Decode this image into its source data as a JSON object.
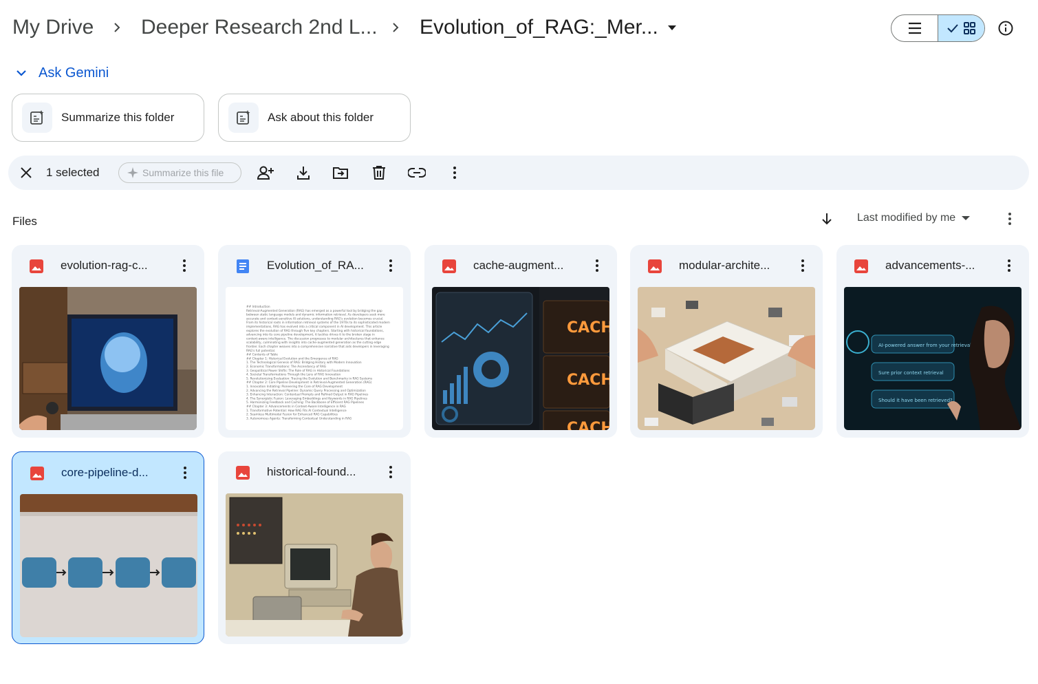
{
  "breadcrumb": {
    "root": "My Drive",
    "parent": "Deeper Research 2nd L...",
    "current": "Evolution_of_RAG:_Mer..."
  },
  "ask_gemini": {
    "label": "Ask Gemini",
    "actions": [
      {
        "label": "Summarize this folder",
        "icon": "gemini-doc-icon"
      },
      {
        "label": "Ask about this folder",
        "icon": "gemini-doc-icon"
      }
    ]
  },
  "selection_bar": {
    "count_label": "1 selected",
    "summarize_file": "Summarize this file",
    "actions": [
      "close-icon",
      "share-icon",
      "download-icon",
      "move-icon",
      "trash-icon",
      "link-icon",
      "more-vert-icon"
    ]
  },
  "files": {
    "section_label": "Files",
    "sort_label": "Last modified by me",
    "items": [
      {
        "name": "evolution-rag-c...",
        "type": "image",
        "icon": "image-file-icon",
        "selected": false
      },
      {
        "name": "Evolution_of_RA...",
        "type": "doc",
        "icon": "doc-file-icon",
        "selected": false
      },
      {
        "name": "cache-augment...",
        "type": "image",
        "icon": "image-file-icon",
        "selected": false
      },
      {
        "name": "modular-archite...",
        "type": "image",
        "icon": "image-file-icon",
        "selected": false
      },
      {
        "name": "advancements-...",
        "type": "image",
        "icon": "image-file-icon",
        "selected": false
      },
      {
        "name": "core-pipeline-d...",
        "type": "image",
        "icon": "image-file-icon",
        "selected": true
      },
      {
        "name": "historical-found...",
        "type": "image",
        "icon": "image-file-icon",
        "selected": false
      }
    ]
  },
  "thumbnails": {
    "cache_words": [
      "CACHE",
      "CACHE",
      "CACHE"
    ],
    "doc_lines": [
      "## Introduction",
      "Retrieval-Augmented Generation (RAG) has emerged as a powerful tool by bridging the gap",
      "between static language models and dynamic information retrieval. As developers seek more",
      "accurate and context-sensitive AI solutions, understanding RAG's evolution becomes crucial.",
      "From its historical roots in information retrieval systems of the 1970s to its sophisticated modern",
      "implementations, RAG has evolved into a critical component in AI development. This article",
      "explores the evolution of RAG through five key chapters. Starting with historical foundations,",
      "advancing into its core pipeline development, it tackles drives it to the broken stage in",
      "context-aware intelligence. The discussion progresses to modular architectures that enhance",
      "scalability, culminating with insights into cache-augmented generation as the cutting edge",
      "frontier. Each chapter weaves into a comprehensive narrative that aids developers in leveraging",
      "RAG's full potential.",
      "## Contents of Table",
      "## Chapter 1: Historical Evolution and the Emergence of RAG",
      "1. The Technological Genesis of RAG: Bridging History with Modern Innovation",
      "2. Economic Transformations: The Ascendancy of RAG",
      "3. Geopolitical Power Shifts: The Role of RAG in Historical Foundations",
      "4. Societal Transformations Through the Lens of RAG Innovation",
      "5. Revolutionizing Evaluation: Tracing the Evolution and Benchmarks in RAG Systems",
      "## Chapter 2: Core Pipeline Development in Retrieval-Augmented Generation (RAG)",
      "1. Innovation Initiating: Pioneering the Core of RAG Development",
      "2. Advancing the Retrieval Pipeline: Dynamic Query Processing and Optimization",
      "3. Enhancing Interaction: Contextual Prompts and Refined Output in RAG Pipelines",
      "4. The Synergistic Fusion: Leveraging Embeddings and Keywords in RAG Pipelines",
      "5. Harmonizing Feedback and Caching: The Backbone of Efficient RAG Pipelines",
      "## Chapter 3: Advancements in Context-Aware Intelligence in RAG",
      "1. Transformative Potential: How RAG Fits AI Contextual Intelligence",
      "2. Seamless Multimodal Fusion for Enhanced RAG Capabilities",
      "3. Autonomous Agents: Transforming Contextual Understanding in RAG"
    ],
    "screen_lines": [
      "AI-powered answer from your retrieval",
      "Sure prior context retrieval",
      "Should it have been retrieved?"
    ]
  },
  "colors": {
    "accent": "#0b57d0",
    "selected_bg": "#c2e7ff",
    "card_bg": "#f0f4f9",
    "image_icon": "#e8453c",
    "doc_icon": "#4285f4"
  }
}
